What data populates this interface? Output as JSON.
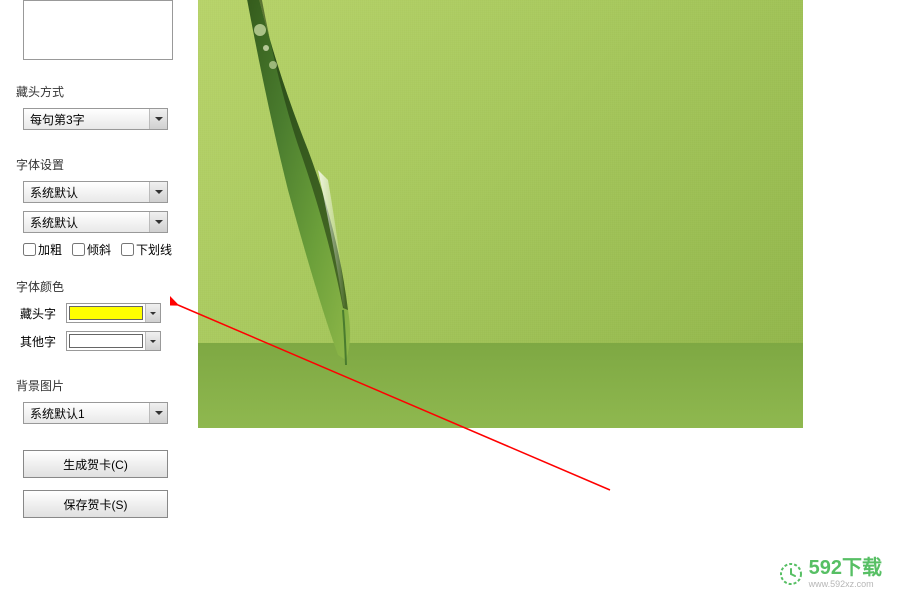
{
  "textarea": {
    "value": ""
  },
  "acrostic": {
    "label": "藏头方式",
    "value": "每句第3字"
  },
  "font_settings": {
    "label": "字体设置",
    "font_value": "系统默认",
    "size_value": "系统默认",
    "bold_label": "加粗",
    "italic_label": "倾斜",
    "underline_label": "下划线"
  },
  "font_color": {
    "label": "字体颜色",
    "acrostic_label": "藏头字",
    "acrostic_color": "#ffff00",
    "other_label": "其他字",
    "other_color": "#ffffff"
  },
  "background": {
    "label": "背景图片",
    "value": "系统默认1"
  },
  "buttons": {
    "generate": "生成贺卡(C)",
    "save": "保存贺卡(S)"
  },
  "watermark": {
    "main": "592下载",
    "sub": "www.592xz.com"
  }
}
